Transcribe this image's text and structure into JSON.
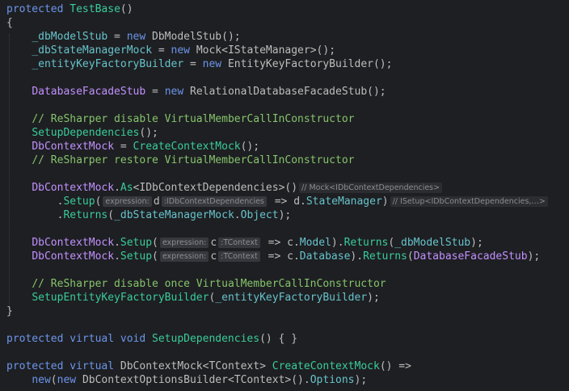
{
  "editor": {
    "lines": [
      [
        {
          "t": "protected ",
          "c": "kw"
        },
        {
          "t": "TestBase",
          "c": "method"
        },
        {
          "t": "()",
          "c": "punct"
        }
      ],
      [
        {
          "t": "{",
          "c": "punct"
        }
      ],
      [
        {
          "t": "    ",
          "c": "plain"
        },
        {
          "t": "_dbModelStub",
          "c": "field"
        },
        {
          "t": " = ",
          "c": "punct"
        },
        {
          "t": "new ",
          "c": "kw"
        },
        {
          "t": "DbModelStub",
          "c": "ident"
        },
        {
          "t": "();",
          "c": "punct"
        }
      ],
      [
        {
          "t": "    ",
          "c": "plain"
        },
        {
          "t": "_dbStateManagerMock",
          "c": "field"
        },
        {
          "t": " = ",
          "c": "punct"
        },
        {
          "t": "new ",
          "c": "kw"
        },
        {
          "t": "Mock",
          "c": "ident"
        },
        {
          "t": "<",
          "c": "punct"
        },
        {
          "t": "IStateManager",
          "c": "ident"
        },
        {
          "t": ">();",
          "c": "punct"
        }
      ],
      [
        {
          "t": "    ",
          "c": "plain"
        },
        {
          "t": "_entityKeyFactoryBuilder",
          "c": "field"
        },
        {
          "t": " = ",
          "c": "punct"
        },
        {
          "t": "new ",
          "c": "kw"
        },
        {
          "t": "EntityKeyFactoryBuilder",
          "c": "ident"
        },
        {
          "t": "();",
          "c": "punct"
        }
      ],
      [],
      [
        {
          "t": "    ",
          "c": "plain"
        },
        {
          "t": "DatabaseFacadeStub",
          "c": "type"
        },
        {
          "t": " = ",
          "c": "punct"
        },
        {
          "t": "new ",
          "c": "kw"
        },
        {
          "t": "RelationalDatabaseFacadeStub",
          "c": "ident"
        },
        {
          "t": "();",
          "c": "punct"
        }
      ],
      [],
      [
        {
          "t": "    ",
          "c": "plain"
        },
        {
          "t": "// ReSharper disable VirtualMemberCallInConstructor",
          "c": "comment"
        }
      ],
      [
        {
          "t": "    ",
          "c": "plain"
        },
        {
          "t": "SetupDependencies",
          "c": "method"
        },
        {
          "t": "();",
          "c": "punct"
        }
      ],
      [
        {
          "t": "    ",
          "c": "plain"
        },
        {
          "t": "DbContextMock",
          "c": "type"
        },
        {
          "t": " = ",
          "c": "punct"
        },
        {
          "t": "CreateContextMock",
          "c": "method"
        },
        {
          "t": "();",
          "c": "punct"
        }
      ],
      [
        {
          "t": "    ",
          "c": "plain"
        },
        {
          "t": "// ReSharper restore VirtualMemberCallInConstructor",
          "c": "comment"
        }
      ],
      [],
      [
        {
          "t": "    ",
          "c": "plain"
        },
        {
          "t": "DbContextMock",
          "c": "type"
        },
        {
          "t": ".",
          "c": "punct"
        },
        {
          "t": "As",
          "c": "method"
        },
        {
          "t": "<",
          "c": "punct"
        },
        {
          "t": "IDbContextDependencies",
          "c": "ident"
        },
        {
          "t": ">()",
          "c": "punct"
        },
        {
          "h": "// Mock<IDbContextDependencies>",
          "c": "hint-type"
        }
      ],
      [
        {
          "t": "        ",
          "c": "plain"
        },
        {
          "t": ".",
          "c": "punct"
        },
        {
          "t": "Setup",
          "c": "method"
        },
        {
          "t": "(",
          "c": "punct"
        },
        {
          "h": "expression:",
          "c": "hint-param"
        },
        {
          "t": "d",
          "c": "param"
        },
        {
          "h": ":IDbContextDependencies",
          "c": "hint-param"
        },
        {
          "t": " => ",
          "c": "punct"
        },
        {
          "t": "d",
          "c": "param"
        },
        {
          "t": ".",
          "c": "punct"
        },
        {
          "t": "StateManager",
          "c": "prop"
        },
        {
          "t": ")",
          "c": "punct"
        },
        {
          "h": "// ISetup<IDbContextDependencies,…>",
          "c": "hint-type"
        }
      ],
      [
        {
          "t": "        ",
          "c": "plain"
        },
        {
          "t": ".",
          "c": "punct"
        },
        {
          "t": "Returns",
          "c": "method"
        },
        {
          "t": "(",
          "c": "punct"
        },
        {
          "t": "_dbStateManagerMock",
          "c": "field"
        },
        {
          "t": ".",
          "c": "punct"
        },
        {
          "t": "Object",
          "c": "prop"
        },
        {
          "t": ");",
          "c": "punct"
        }
      ],
      [],
      [
        {
          "t": "    ",
          "c": "plain"
        },
        {
          "t": "DbContextMock",
          "c": "type"
        },
        {
          "t": ".",
          "c": "punct"
        },
        {
          "t": "Setup",
          "c": "method"
        },
        {
          "t": "(",
          "c": "punct"
        },
        {
          "h": "expression:",
          "c": "hint-param"
        },
        {
          "t": "c",
          "c": "param"
        },
        {
          "h": ":TContext",
          "c": "hint-param"
        },
        {
          "t": " => ",
          "c": "punct"
        },
        {
          "t": "c",
          "c": "param"
        },
        {
          "t": ".",
          "c": "punct"
        },
        {
          "t": "Model",
          "c": "prop"
        },
        {
          "t": ").",
          "c": "punct"
        },
        {
          "t": "Returns",
          "c": "method"
        },
        {
          "t": "(",
          "c": "punct"
        },
        {
          "t": "_dbModelStub",
          "c": "field"
        },
        {
          "t": ");",
          "c": "punct"
        }
      ],
      [
        {
          "t": "    ",
          "c": "plain"
        },
        {
          "t": "DbContextMock",
          "c": "type"
        },
        {
          "t": ".",
          "c": "punct"
        },
        {
          "t": "Setup",
          "c": "method"
        },
        {
          "t": "(",
          "c": "punct"
        },
        {
          "h": "expression:",
          "c": "hint-param"
        },
        {
          "t": "c",
          "c": "param"
        },
        {
          "h": ":TContext",
          "c": "hint-param"
        },
        {
          "t": " => ",
          "c": "punct"
        },
        {
          "t": "c",
          "c": "param"
        },
        {
          "t": ".",
          "c": "punct"
        },
        {
          "t": "Database",
          "c": "prop"
        },
        {
          "t": ").",
          "c": "punct"
        },
        {
          "t": "Returns",
          "c": "method"
        },
        {
          "t": "(",
          "c": "punct"
        },
        {
          "t": "DatabaseFacadeStub",
          "c": "type"
        },
        {
          "t": ");",
          "c": "punct"
        }
      ],
      [],
      [
        {
          "t": "    ",
          "c": "plain"
        },
        {
          "t": "// ReSharper disable once VirtualMemberCallInConstructor",
          "c": "comment"
        }
      ],
      [
        {
          "t": "    ",
          "c": "plain"
        },
        {
          "t": "SetupEntityKeyFactoryBuilder",
          "c": "method"
        },
        {
          "t": "(",
          "c": "punct"
        },
        {
          "t": "_entityKeyFactoryBuilder",
          "c": "field"
        },
        {
          "t": ");",
          "c": "punct"
        }
      ],
      [
        {
          "t": "}",
          "c": "punct"
        }
      ],
      [],
      [
        {
          "t": "protected virtual void ",
          "c": "kw"
        },
        {
          "t": "SetupDependencies",
          "c": "method"
        },
        {
          "t": "() { }",
          "c": "punct"
        }
      ],
      [],
      [
        {
          "t": "protected virtual ",
          "c": "kw"
        },
        {
          "t": "DbContextMock",
          "c": "ident"
        },
        {
          "t": "<",
          "c": "punct"
        },
        {
          "t": "TContext",
          "c": "ident"
        },
        {
          "t": "> ",
          "c": "punct"
        },
        {
          "t": "CreateContextMock",
          "c": "method"
        },
        {
          "t": "() =>",
          "c": "punct"
        }
      ],
      [
        {
          "t": "    ",
          "c": "plain"
        },
        {
          "t": "new",
          "c": "kw"
        },
        {
          "t": "(",
          "c": "punct"
        },
        {
          "t": "new ",
          "c": "kw"
        },
        {
          "t": "DbContextOptionsBuilder",
          "c": "ident"
        },
        {
          "t": "<",
          "c": "punct"
        },
        {
          "t": "TContext",
          "c": "ident"
        },
        {
          "t": ">().",
          "c": "punct"
        },
        {
          "t": "Options",
          "c": "prop"
        },
        {
          "t": ");",
          "c": "punct"
        }
      ]
    ]
  }
}
